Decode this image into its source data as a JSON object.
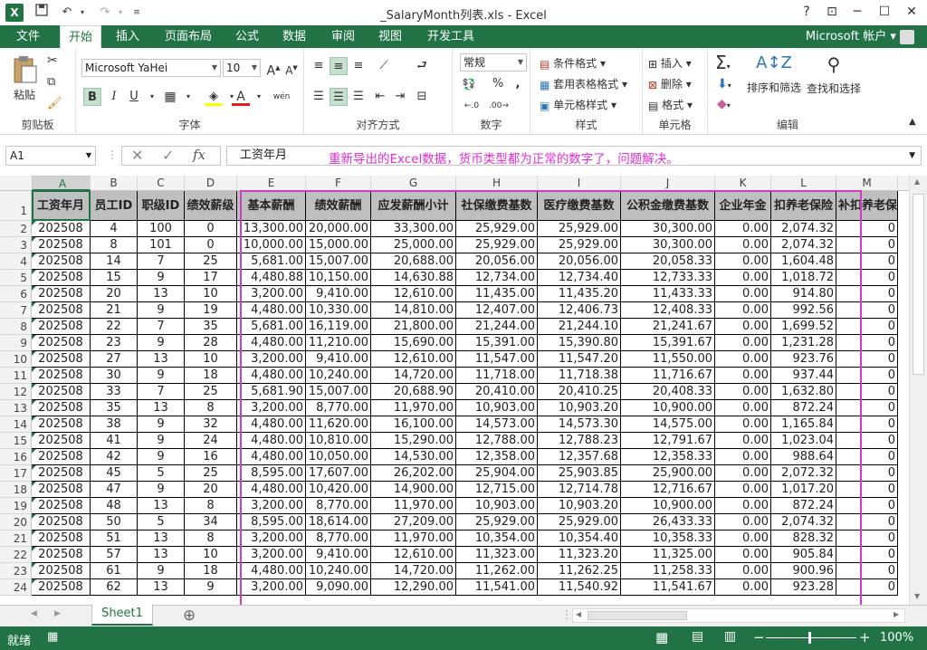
{
  "app": {
    "title": "_SalaryMonth列表.xls - Excel",
    "logo": "X",
    "quick_access": {
      "save": "save-icon",
      "undo": "undo-icon",
      "redo": "redo-icon"
    },
    "window_buttons": {
      "help": "?",
      "restore_ribbon": "⊡",
      "minimize": "─",
      "maximize": "☐",
      "close": "✕"
    }
  },
  "tabs": [
    "文件",
    "开始",
    "插入",
    "页面布局",
    "公式",
    "数据",
    "审阅",
    "视图",
    "开发工具"
  ],
  "active_tab": "开始",
  "account": "Microsoft 帐户",
  "ribbon": {
    "clipboard": {
      "paste": "粘贴",
      "label": "剪贴板"
    },
    "font": {
      "name": "Microsoft YaHei",
      "size": "10",
      "bold": "B",
      "italic": "I",
      "underline": "U",
      "wen": "wén",
      "label": "字体"
    },
    "alignment": {
      "label": "对齐方式"
    },
    "number": {
      "format": "常规",
      "percent": "%",
      "comma": ",",
      "label": "数字"
    },
    "styles": {
      "conditional": "条件格式",
      "table": "套用表格格式",
      "cell": "单元格样式",
      "label": "样式"
    },
    "cells": {
      "insert": "插入",
      "delete": "删除",
      "format": "格式",
      "label": "单元格"
    },
    "editing": {
      "sort": "排序和筛选",
      "find": "查找和选择",
      "label": "编辑"
    }
  },
  "formula_bar": {
    "name_box": "A1",
    "fx": "fx",
    "content": "工资年月",
    "annotation": "重新导出的Excel数据，货币类型都为正常的数字了，问题解决。"
  },
  "columns": [
    "A",
    "B",
    "C",
    "D",
    "E",
    "F",
    "G",
    "H",
    "I",
    "J",
    "K",
    "L",
    "M"
  ],
  "headers": [
    "工资年月",
    "员工ID",
    "职级ID",
    "绩效薪级",
    "基本薪酬",
    "绩效薪酬",
    "应发薪酬小计",
    "社保缴费基数",
    "医疗缴费基数",
    "公积金缴费基数",
    "企业年金",
    "扣养老保险",
    "补扣养老保"
  ],
  "rows": [
    [
      "202508",
      "4",
      "100",
      "0",
      "13,300.00",
      "20,000.00",
      "33,300.00",
      "25,929.00",
      "25,929.00",
      "30,300.00",
      "0.00",
      "2,074.32",
      "0"
    ],
    [
      "202508",
      "8",
      "101",
      "0",
      "10,000.00",
      "15,000.00",
      "25,000.00",
      "25,929.00",
      "25,929.00",
      "30,300.00",
      "0.00",
      "2,074.32",
      "0"
    ],
    [
      "202508",
      "14",
      "7",
      "25",
      "5,681.00",
      "15,007.00",
      "20,688.00",
      "20,056.00",
      "20,056.00",
      "20,058.33",
      "0.00",
      "1,604.48",
      "0"
    ],
    [
      "202508",
      "15",
      "9",
      "17",
      "4,480.88",
      "10,150.00",
      "14,630.88",
      "12,734.00",
      "12,734.40",
      "12,733.33",
      "0.00",
      "1,018.72",
      "0"
    ],
    [
      "202508",
      "20",
      "13",
      "10",
      "3,200.00",
      "9,410.00",
      "12,610.00",
      "11,435.00",
      "11,435.20",
      "11,433.33",
      "0.00",
      "914.80",
      "0"
    ],
    [
      "202508",
      "21",
      "9",
      "19",
      "4,480.00",
      "10,330.00",
      "14,810.00",
      "12,407.00",
      "12,406.73",
      "12,408.33",
      "0.00",
      "992.56",
      "0"
    ],
    [
      "202508",
      "22",
      "7",
      "35",
      "5,681.00",
      "16,119.00",
      "21,800.00",
      "21,244.00",
      "21,244.10",
      "21,241.67",
      "0.00",
      "1,699.52",
      "0"
    ],
    [
      "202508",
      "23",
      "9",
      "28",
      "4,480.00",
      "11,210.00",
      "15,690.00",
      "15,391.00",
      "15,390.80",
      "15,391.67",
      "0.00",
      "1,231.28",
      "0"
    ],
    [
      "202508",
      "27",
      "13",
      "10",
      "3,200.00",
      "9,410.00",
      "12,610.00",
      "11,547.00",
      "11,547.20",
      "11,550.00",
      "0.00",
      "923.76",
      "0"
    ],
    [
      "202508",
      "30",
      "9",
      "18",
      "4,480.00",
      "10,240.00",
      "14,720.00",
      "11,718.00",
      "11,718.38",
      "11,716.67",
      "0.00",
      "937.44",
      "0"
    ],
    [
      "202508",
      "33",
      "7",
      "25",
      "5,681.90",
      "15,007.00",
      "20,688.90",
      "20,410.00",
      "20,410.25",
      "20,408.33",
      "0.00",
      "1,632.80",
      "0"
    ],
    [
      "202508",
      "35",
      "13",
      "8",
      "3,200.00",
      "8,770.00",
      "11,970.00",
      "10,903.00",
      "10,903.20",
      "10,900.00",
      "0.00",
      "872.24",
      "0"
    ],
    [
      "202508",
      "38",
      "9",
      "32",
      "4,480.00",
      "11,620.00",
      "16,100.00",
      "14,573.00",
      "14,573.30",
      "14,575.00",
      "0.00",
      "1,165.84",
      "0"
    ],
    [
      "202508",
      "41",
      "9",
      "24",
      "4,480.00",
      "10,810.00",
      "15,290.00",
      "12,788.00",
      "12,788.23",
      "12,791.67",
      "0.00",
      "1,023.04",
      "0"
    ],
    [
      "202508",
      "42",
      "9",
      "16",
      "4,480.00",
      "10,050.00",
      "14,530.00",
      "12,358.00",
      "12,357.68",
      "12,358.33",
      "0.00",
      "988.64",
      "0"
    ],
    [
      "202508",
      "45",
      "5",
      "25",
      "8,595.00",
      "17,607.00",
      "26,202.00",
      "25,904.00",
      "25,903.85",
      "25,900.00",
      "0.00",
      "2,072.32",
      "0"
    ],
    [
      "202508",
      "47",
      "9",
      "20",
      "4,480.00",
      "10,420.00",
      "14,900.00",
      "12,715.00",
      "12,714.78",
      "12,716.67",
      "0.00",
      "1,017.20",
      "0"
    ],
    [
      "202508",
      "48",
      "13",
      "8",
      "3,200.00",
      "8,770.00",
      "11,970.00",
      "10,903.00",
      "10,903.20",
      "10,900.00",
      "0.00",
      "872.24",
      "0"
    ],
    [
      "202508",
      "50",
      "5",
      "34",
      "8,595.00",
      "18,614.00",
      "27,209.00",
      "25,929.00",
      "25,929.00",
      "26,433.33",
      "0.00",
      "2,074.32",
      "0"
    ],
    [
      "202508",
      "51",
      "13",
      "8",
      "3,200.00",
      "8,770.00",
      "11,970.00",
      "10,354.00",
      "10,354.40",
      "10,358.33",
      "0.00",
      "828.32",
      "0"
    ],
    [
      "202508",
      "57",
      "13",
      "10",
      "3,200.00",
      "9,410.00",
      "12,610.00",
      "11,323.00",
      "11,323.20",
      "11,325.00",
      "0.00",
      "905.84",
      "0"
    ],
    [
      "202508",
      "61",
      "9",
      "18",
      "4,480.00",
      "10,240.00",
      "14,720.00",
      "11,262.00",
      "11,262.25",
      "11,258.33",
      "0.00",
      "900.96",
      "0"
    ],
    [
      "202508",
      "62",
      "13",
      "9",
      "3,200.00",
      "9,090.00",
      "12,290.00",
      "11,541.00",
      "11,540.92",
      "11,541.67",
      "0.00",
      "923.28",
      "0"
    ]
  ],
  "sheet_tab": "Sheet1",
  "add_sheet": "⊕",
  "status": {
    "ready": "就绪",
    "zoom": "100%",
    "zoom_minus": "−",
    "zoom_plus": "+"
  },
  "colors": {
    "accent": "#217346",
    "header_fill": "#bfbfbf",
    "highlight": "#d03ac8",
    "annotation": "#e22cd7"
  }
}
